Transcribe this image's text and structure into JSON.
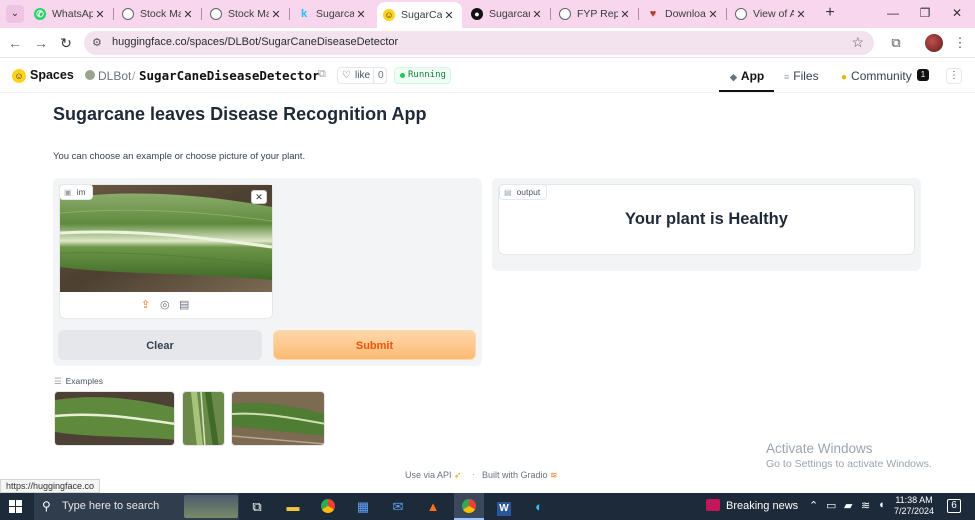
{
  "browser": {
    "tabs": [
      {
        "title": "WhatsApp",
        "icon": "whatsapp-icon",
        "color": "#25d366"
      },
      {
        "title": "Stock Ma",
        "icon": "globe-icon",
        "color": "#5f6368"
      },
      {
        "title": "Stock Ma",
        "icon": "globe-icon",
        "color": "#5f6368"
      },
      {
        "title": "Sugarcan",
        "icon": "kaggle-icon",
        "color": "#20beff"
      },
      {
        "title": "SugarCan",
        "icon": "huggingface-icon",
        "color": "#ffd21e"
      },
      {
        "title": "Sugarcan",
        "icon": "github-icon",
        "color": "#111111"
      },
      {
        "title": "FYP Repo",
        "icon": "globe-icon",
        "color": "#5f6368"
      },
      {
        "title": "Downloa",
        "icon": "heart-icon",
        "color": "#c0392b"
      },
      {
        "title": "View of A",
        "icon": "globe-icon",
        "color": "#5f6368"
      }
    ],
    "active_tab_index": 4,
    "url": "huggingface.co/spaces/DLBot/SugarCaneDiseaseDetector"
  },
  "hf": {
    "brand": "Spaces",
    "owner": "DLBot",
    "slash": "/",
    "repo": "SugarCaneDiseaseDetector",
    "like_label": "like",
    "like_count": "0",
    "status": "Running",
    "nav": {
      "app": "App",
      "files": "Files",
      "community": "Community",
      "community_count": "1"
    }
  },
  "app": {
    "title": "Sugarcane leaves Disease Recognition App",
    "description": "You can choose an example or choose picture of your plant.",
    "input_label": "im",
    "output_label": "output",
    "output_text": "Your plant is Healthy",
    "clear_label": "Clear",
    "submit_label": "Submit",
    "examples_label": "Examples"
  },
  "footer": {
    "api": "Use via API",
    "dot": "·",
    "gradio": "Built with Gradio"
  },
  "watermark": {
    "line1": "Activate Windows",
    "line2": "Go to Settings to activate Windows."
  },
  "statusbar": {
    "url": "https://huggingface.co"
  },
  "taskbar": {
    "search_placeholder": "Type here to search",
    "news": "Breaking news",
    "time": "11:38 AM",
    "date": "7/27/2024",
    "notifications": "6"
  },
  "colors": {
    "accent": "#f97316",
    "running": "#22c55e",
    "hf_yellow": "#ffd21e"
  }
}
